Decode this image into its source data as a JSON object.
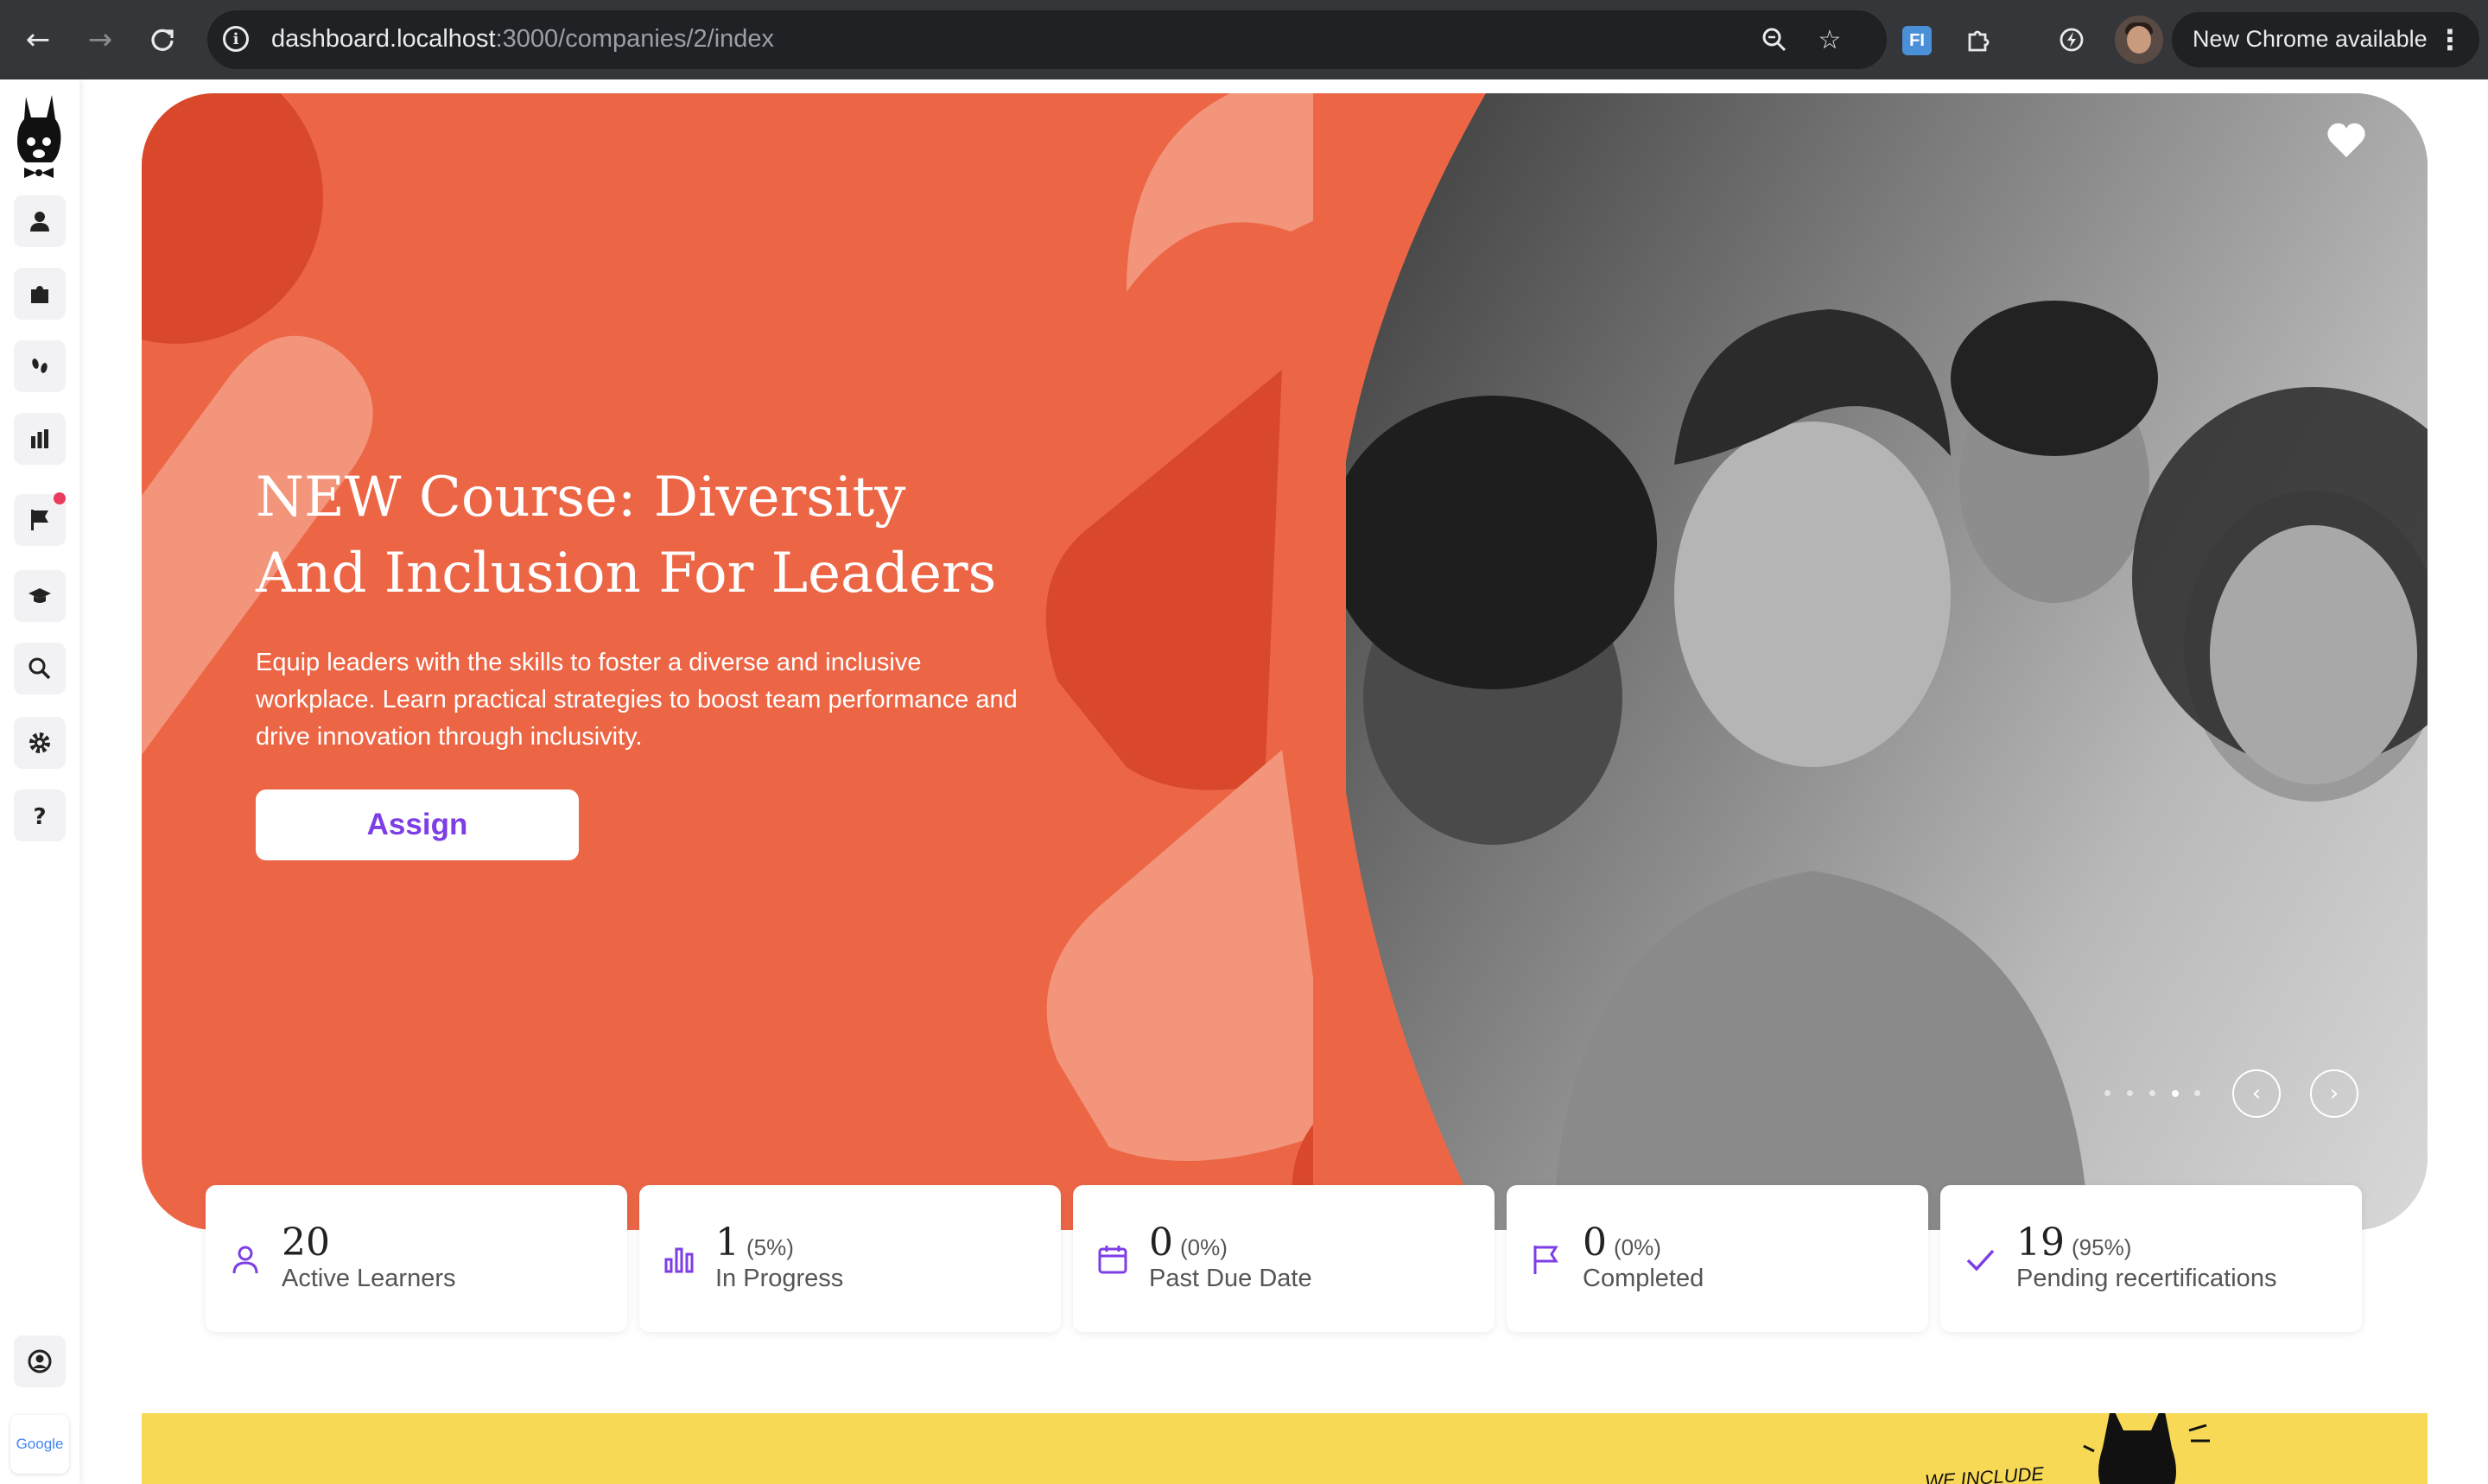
{
  "browser": {
    "url_host": "dashboard.localhost",
    "url_path": ":3000/companies/2/index",
    "extension_badge": "FI",
    "update_label": "New Chrome available",
    "icons": [
      "back-arrow-icon",
      "forward-arrow-icon",
      "reload-icon",
      "info-icon",
      "zoom-icon",
      "star-icon",
      "extensions-icon",
      "performance-icon",
      "kebab-menu-icon"
    ]
  },
  "sidebar": {
    "items": [
      {
        "name": "users",
        "icon": "person-icon"
      },
      {
        "name": "courses",
        "icon": "puzzle-icon"
      },
      {
        "name": "paths",
        "icon": "footsteps-icon"
      },
      {
        "name": "reports",
        "icon": "bar-chart-icon"
      },
      {
        "name": "flags",
        "icon": "flag-icon",
        "has_notification": true
      },
      {
        "name": "academy",
        "icon": "graduation-cap-icon"
      },
      {
        "name": "search",
        "icon": "search-icon"
      },
      {
        "name": "settings",
        "icon": "gear-icon"
      },
      {
        "name": "help",
        "icon": "question-icon"
      },
      {
        "name": "account",
        "icon": "user-circle-icon"
      }
    ],
    "google_label": "Google"
  },
  "hero": {
    "title_line1": "NEW Course: Diversity",
    "title_line2": "And Inclusion For Leaders",
    "description": "Equip leaders with the skills to foster a diverse and inclusive workplace. Learn practical strategies to boost team performance and drive innovation through inclusivity.",
    "assign_label": "Assign",
    "prev_label": "‹",
    "next_label": "›",
    "slide_count": 5,
    "active_slide": 4
  },
  "stats": [
    {
      "value": "20",
      "percent": "",
      "label": "Active Learners",
      "icon": "person-icon"
    },
    {
      "value": "1",
      "percent": "(5%)",
      "label": "In Progress",
      "icon": "bar-chart-icon"
    },
    {
      "value": "0",
      "percent": "(0%)",
      "label": "Past Due Date",
      "icon": "calendar-icon"
    },
    {
      "value": "0",
      "percent": "(0%)",
      "label": "Completed",
      "icon": "flag-icon"
    },
    {
      "value": "19",
      "percent": "(95%)",
      "label": "Pending recertifications",
      "icon": "check-icon"
    }
  ],
  "banner": {
    "text": "WE INCLUDE"
  },
  "colors": {
    "hero_orange": "#ec6646",
    "hero_dark": "#d9482a",
    "hero_light": "#f3957b",
    "accent_purple": "#7d3ee6",
    "banner_yellow": "#f7d955"
  }
}
